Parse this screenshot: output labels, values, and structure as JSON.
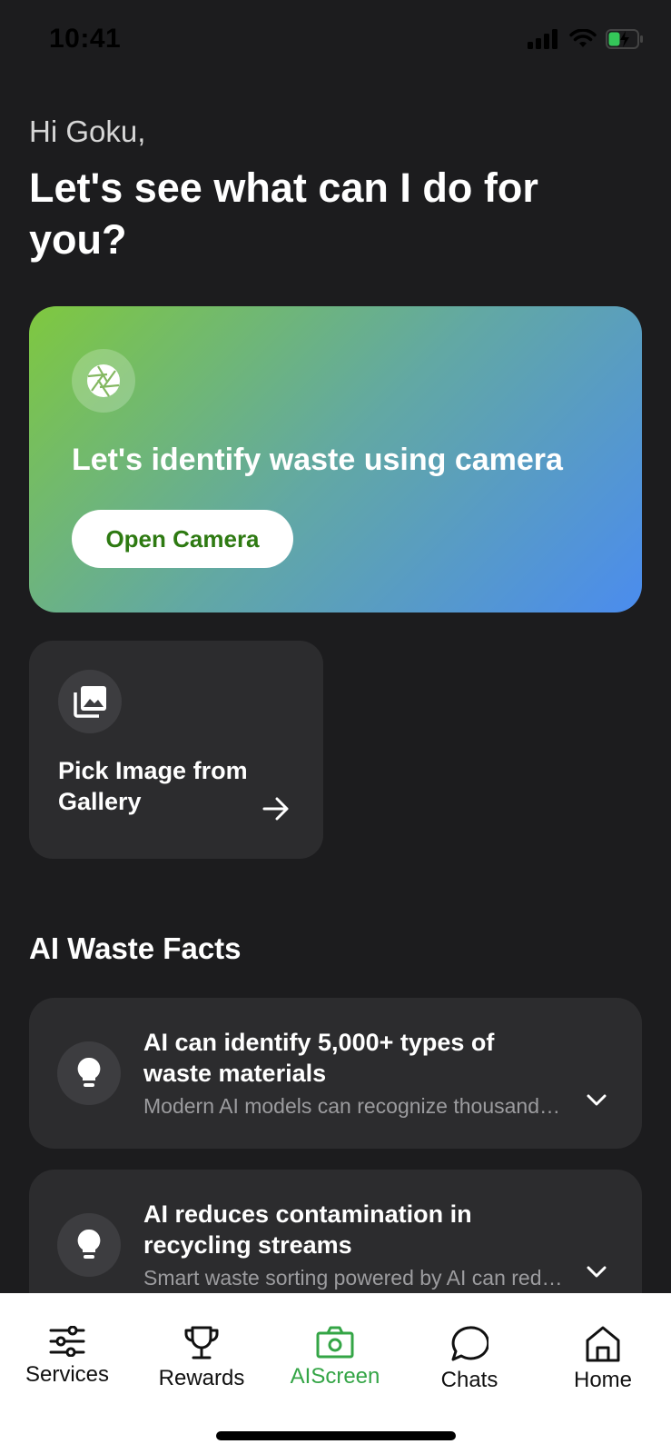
{
  "status_bar": {
    "time": "10:41"
  },
  "header": {
    "greeting": "Hi Goku,",
    "headline": "Let's see what can I do for you?"
  },
  "camera_card": {
    "icon": "aperture-icon",
    "title": "Let's identify waste using camera",
    "button_label": "Open Camera",
    "gradient": [
      "#7fc83f",
      "#4b8cee"
    ]
  },
  "gallery_card": {
    "icon": "gallery-icon",
    "label": "Pick Image from Gallery"
  },
  "facts": {
    "section_title": "AI Waste Facts",
    "items": [
      {
        "icon": "lightbulb-icon",
        "title": "AI can identify 5,000+ types of waste materials",
        "description": "Modern AI models can recognize thousands of different waste materials"
      },
      {
        "icon": "lightbulb-icon",
        "title": "AI reduces contamination in recycling streams",
        "description": "Smart waste sorting powered by AI can reduce contamination"
      }
    ]
  },
  "tab_bar": {
    "active_color": "#34a546",
    "tabs": [
      {
        "label": "Services",
        "icon": "sliders-icon"
      },
      {
        "label": "Rewards",
        "icon": "trophy-icon"
      },
      {
        "label": "AIScreen",
        "icon": "camera-icon",
        "active": true
      },
      {
        "label": "Chats",
        "icon": "chat-bubble-icon"
      },
      {
        "label": "Home",
        "icon": "home-icon"
      }
    ]
  }
}
